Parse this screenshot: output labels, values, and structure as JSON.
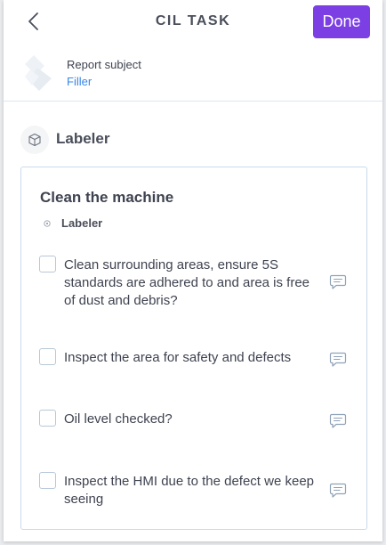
{
  "header": {
    "title": "CIL TASK",
    "done_label": "Done",
    "accent_color": "#7b3fe4"
  },
  "report_subject": {
    "label": "Report subject",
    "value": "Filler",
    "logo_icon": "brand-logo-icon"
  },
  "section": {
    "title": "Labeler",
    "icon": "cube-icon"
  },
  "card": {
    "title": "Clean the machine",
    "subtitle": "Labeler",
    "tasks": [
      {
        "label": "Clean surrounding areas, ensure 5S standards are adhered to and area is free of dust and debris?",
        "checked": false
      },
      {
        "label": "Inspect the area for safety and defects",
        "checked": false
      },
      {
        "label": "Oil level checked?",
        "checked": false
      },
      {
        "label": "Inspect the HMI due to the defect we keep seeing",
        "checked": false
      }
    ]
  }
}
